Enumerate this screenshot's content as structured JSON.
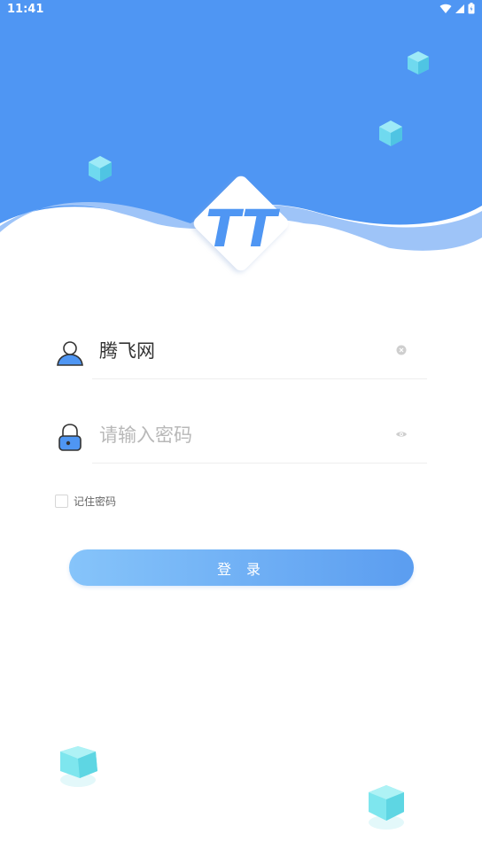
{
  "status_bar": {
    "time": "11:41",
    "icons": [
      "wifi-icon",
      "signal-icon",
      "battery-icon"
    ]
  },
  "header": {
    "logo_text": "TT"
  },
  "login_form": {
    "username": {
      "value": "腾飞网",
      "icon": "user-icon",
      "clear_icon": "clear-icon"
    },
    "password": {
      "placeholder": "请输入密码",
      "icon": "lock-icon",
      "visibility_icon": "eye-icon"
    },
    "remember_password": {
      "label": "记住密码",
      "checked": false
    },
    "login_button": {
      "label": "登 录"
    }
  },
  "colors": {
    "primary_blue": "#4f96f3",
    "light_wave": "#96bff7",
    "button_gradient_start": "#86c4fa",
    "button_gradient_end": "#5b9df0",
    "cube_color": "#6fe3ea"
  }
}
